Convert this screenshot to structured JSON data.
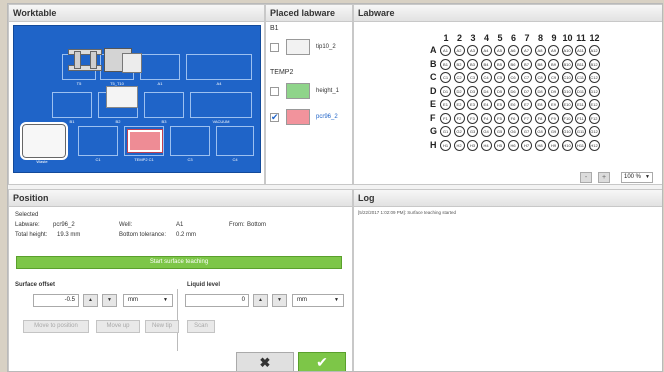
{
  "worktable": {
    "title": "Worktable",
    "slots": {
      "t5": "T5",
      "t10": "T5_T10",
      "a1": "A1",
      "a4": "A4",
      "b1": "B1",
      "b2": "B2",
      "b3": "B3",
      "vacuum": "VACUUM",
      "waste": "Waste",
      "c1": "C1",
      "temp2": "TEMP2 C1",
      "c3": "C3",
      "c4": "C4"
    }
  },
  "placed": {
    "title": "Placed labware",
    "group1": "B1",
    "group2": "TEMP2",
    "items": [
      {
        "label": "tip10_2",
        "checked": false,
        "thumb_color": "#f2f2f2"
      },
      {
        "label": "height_1",
        "checked": false,
        "thumb_color": "#8fd48a"
      },
      {
        "label": "pcr96_2",
        "checked": true,
        "thumb_color": "#f2939c"
      }
    ]
  },
  "labware": {
    "title": "Labware",
    "columns": [
      "1",
      "2",
      "3",
      "4",
      "5",
      "6",
      "7",
      "8",
      "9",
      "10",
      "11",
      "12"
    ],
    "rows": [
      "A",
      "B",
      "C",
      "D",
      "E",
      "F",
      "G",
      "H"
    ],
    "zoom": "100 %",
    "zoom_minus": "-",
    "zoom_plus": "+"
  },
  "position": {
    "title": "Position",
    "selected_label": "Selected",
    "labware_label": "Labware:",
    "labware_value": "pcr96_2",
    "well_label": "Well:",
    "well_value": "A1",
    "from_label": "From:",
    "from_value": "Bottom",
    "total_height_label": "Total height:",
    "total_height_value": "19.3 mm",
    "bottom_tol_label": "Bottom tolerance:",
    "bottom_tol_value": "0.2 mm",
    "start_button": "Start surface teaching",
    "surface_offset_label": "Surface offset",
    "surface_offset_value": "-0.5",
    "surface_unit": "mm",
    "liquid_level_label": "Liquid level",
    "liquid_level_value": "0",
    "liquid_unit": "mm",
    "move_to_position": "Move to position",
    "move_up": "Move up",
    "new_tip": "New tip",
    "scan": "Scan",
    "cancel_glyph": "✖",
    "ok_glyph": "✔"
  },
  "log": {
    "title": "Log",
    "entries": [
      "[5/22/2017 1:02:09 PM]: Surface teaching started"
    ]
  },
  "colors": {
    "accent_green": "#7dc648",
    "deck_blue": "#1f64c8",
    "selected_red": "#ee8c95"
  }
}
